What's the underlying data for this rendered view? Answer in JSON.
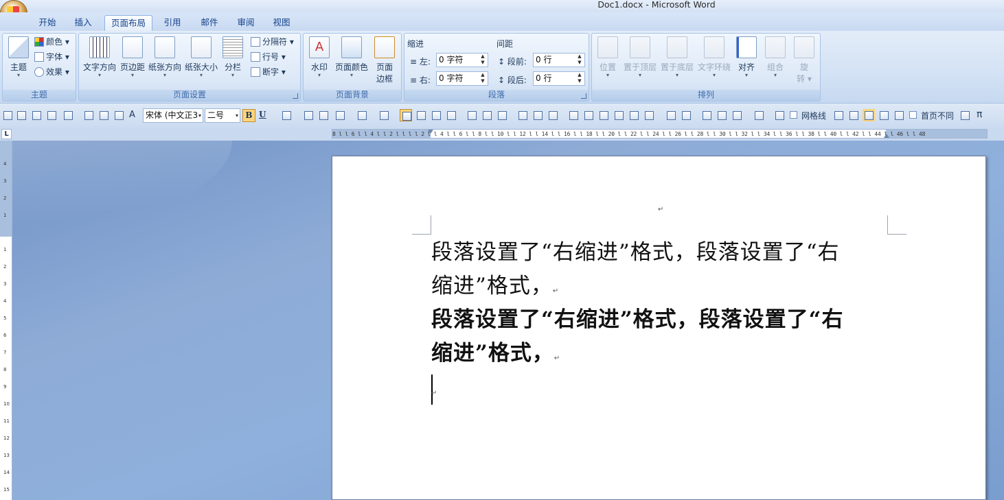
{
  "window": {
    "title": "Doc1.docx - Microsoft Word"
  },
  "tabs": [
    {
      "label": "开始"
    },
    {
      "label": "插入"
    },
    {
      "label": "页面布局",
      "active": true
    },
    {
      "label": "引用"
    },
    {
      "label": "邮件"
    },
    {
      "label": "审阅"
    },
    {
      "label": "视图"
    }
  ],
  "ribbon": {
    "theme_group": {
      "label": "主题",
      "theme_button": "主题",
      "colors": "颜色",
      "fonts": "字体",
      "effects": "效果"
    },
    "page_setup_group": {
      "label": "页面设置",
      "text_direction": "文字方向",
      "margins": "页边距",
      "orientation": "纸张方向",
      "size": "纸张大小",
      "columns": "分栏",
      "breaks": "分隔符",
      "line_numbers": "行号",
      "hyphenation": "断字"
    },
    "page_background_group": {
      "label": "页面背景",
      "watermark": "水印",
      "page_color": "页面颜色",
      "page_borders_l1": "页面",
      "page_borders_l2": "边框"
    },
    "paragraph_group": {
      "label": "段落",
      "indent_title": "缩进",
      "spacing_title": "间距",
      "left_label": "左:",
      "left_value": "0 字符",
      "right_label": "右:",
      "right_value": "0 字符",
      "before_label": "段前:",
      "before_value": "0 行",
      "after_label": "段后:",
      "after_value": "0 行"
    },
    "arrange_group": {
      "label": "排列",
      "position": "位置",
      "bring_front": "置于顶层",
      "send_back": "置于底层",
      "text_wrap": "文字环绕",
      "align": "对齐",
      "group": "组合",
      "rotate_l1": "旋",
      "rotate_l2": "转"
    }
  },
  "toolbar": {
    "font_name": "宋体 (中文正3",
    "font_size": "二号",
    "bold": "B",
    "underline": "U",
    "font_style": "A",
    "gridlines": "网格线",
    "first_page_diff": "首页不同",
    "pi": "π"
  },
  "ruler": {
    "corner": "L",
    "h_text": "8 l  l 6 l  l 4 l  l 2 l  l  l  l 2 l  l 4 l  l 6 l  l 8 l  l 10 l  l 12 l  l 14 l  l 16 l  l 18 l  l 20 l  l 22 l  l 24 l  l 26 l  l 28 l  l 30 l  l 32 l  l 34 l  l 36 l  l 38 l  l 40 l  l 42 l  l 44 l  l 46 l  l 48",
    "v_numbers": [
      "4",
      "3",
      "2",
      "1",
      "",
      "1",
      "2",
      "3",
      "4",
      "5",
      "6",
      "7",
      "8",
      "9",
      "10",
      "11",
      "12",
      "13",
      "14",
      "15"
    ]
  },
  "document": {
    "header_mark": "↵",
    "paragraphs": [
      {
        "line1": "段落设置了“右缩进”格式，段落设置了“右",
        "line2": "缩进”格式，",
        "mark": "↵",
        "bold": false
      },
      {
        "line1": "段落设置了“右缩进”格式，段落设置了“右",
        "line2": "缩进”格式，",
        "mark": "↵",
        "bold": true
      }
    ],
    "empty_mark": "↵"
  }
}
